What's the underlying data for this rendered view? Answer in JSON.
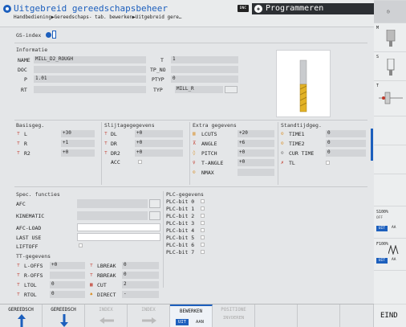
{
  "header": {
    "title": "Uitgebreid gereedschapsbeheer",
    "breadcrumb": "Handbediening▶Gereedschaps- tab. bewerken▶Uitgebreid gere…",
    "dnc": "DNC",
    "mode": "Programmeren"
  },
  "gs_index": {
    "label": "GS-index"
  },
  "informatie": {
    "title": "Informatie",
    "name_label": "NAME",
    "name_value": "MILL_D2_ROUGH",
    "t_label": "T",
    "t_value": "1",
    "doc_label": "DOC",
    "doc_value": "",
    "tpno_label": "TP_NO",
    "tpno_value": "",
    "p_label": "P",
    "p_value": "1.01",
    "ptyp_label": "PTYP",
    "ptyp_value": "0",
    "rt_label": "RT",
    "rt_value": "",
    "typ_label": "TYP",
    "typ_value": "MILL_R"
  },
  "basisgeg": {
    "title": "Basisgeg.",
    "rows": [
      {
        "label": "L",
        "value": "+30"
      },
      {
        "label": "R",
        "value": "+1"
      },
      {
        "label": "R2",
        "value": "+0"
      }
    ]
  },
  "slijtage": {
    "title": "Slijtagegegevens",
    "rows": [
      {
        "label": "DL",
        "value": "+0"
      },
      {
        "label": "DR",
        "value": "+0"
      },
      {
        "label": "DR2",
        "value": "+0"
      }
    ],
    "acc_label": "ACC"
  },
  "extra": {
    "title": "Extra gegevens",
    "rows": [
      {
        "label": "LCUTS",
        "value": "+20"
      },
      {
        "label": "ANGLE",
        "value": "+6"
      },
      {
        "label": "PITCH",
        "value": "+0"
      },
      {
        "label": "T-ANGLE",
        "value": "+0"
      },
      {
        "label": "NMAX",
        "value": ""
      }
    ]
  },
  "standtijd": {
    "title": "Standtijdgeg.",
    "rows": [
      {
        "label": "TIME1",
        "value": "0"
      },
      {
        "label": "TIME2",
        "value": "0"
      },
      {
        "label": "CUR TIME",
        "value": "0"
      }
    ],
    "tl_label": "TL"
  },
  "spec": {
    "title": "Spec. functies",
    "rows": [
      "AFC",
      "KINEMATIC",
      "AFC-LOAD",
      "LAST USE",
      "LIFTOFF"
    ]
  },
  "plc": {
    "title": "PLC-gegevens",
    "bits": [
      "PLC-bit 0",
      "PLC-bit 1",
      "PLC-bit 2",
      "PLC-bit 3",
      "PLC-bit 4",
      "PLC-bit 5",
      "PLC-bit 6",
      "PLC-bit 7"
    ]
  },
  "tt": {
    "title": "TT-gegevens",
    "left": [
      {
        "label": "L-OFFS",
        "value": "+0"
      },
      {
        "label": "R-OFFS",
        "value": ""
      },
      {
        "label": "LTOL",
        "value": "0"
      },
      {
        "label": "RTOL",
        "value": "0"
      }
    ],
    "right": [
      {
        "label": "LBREAK",
        "value": "0"
      },
      {
        "label": "RBREAK",
        "value": "0"
      },
      {
        "label": "CUT",
        "value": "2"
      },
      {
        "label": "DIRECT",
        "value": "-"
      }
    ]
  },
  "softkeys": [
    {
      "label": "GEREEDSCH"
    },
    {
      "label": "GEREEDSCH"
    },
    {
      "label": "INDEX"
    },
    {
      "label": "INDEX"
    },
    {
      "label": "BEWERKEN",
      "uit": "UIT",
      "aan": "AAN"
    },
    {
      "label": "POSITIONE",
      "sub": "INVOEREN"
    },
    {
      "label": ""
    },
    {
      "label": ""
    }
  ],
  "end_key": "EIND",
  "right_panel": {
    "s100": "S100%",
    "f100": "F100%",
    "off": "OFF",
    "uit": "UIT",
    "aa": "AA",
    "m": "M",
    "s": "S",
    "t": "T"
  },
  "colors": {
    "blue": "#1c5fbd",
    "red": "#c0392b",
    "orange": "#d88b1e"
  }
}
